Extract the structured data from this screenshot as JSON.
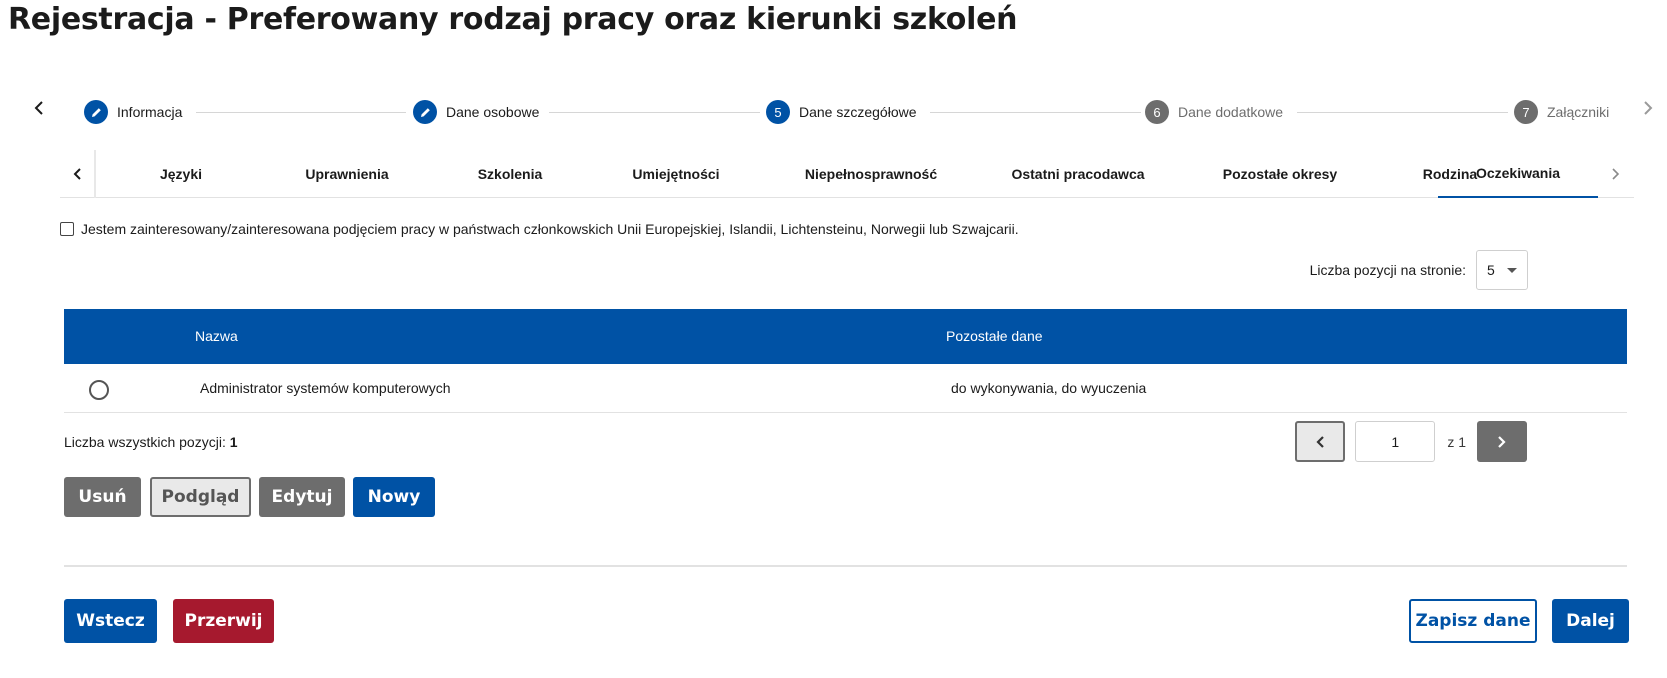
{
  "page": {
    "title": "Rejestracja - Preferowany rodzaj pracy oraz kierunki szkoleń"
  },
  "stepper": {
    "steps": [
      {
        "label": "Informacja",
        "marker": "✎",
        "state": "done"
      },
      {
        "label": "Dane osobowe",
        "marker": "✎",
        "state": "done"
      },
      {
        "label": "Dane szczegółowe",
        "marker": "5",
        "state": "current"
      },
      {
        "label": "Dane dodatkowe",
        "marker": "6",
        "state": "upcoming"
      },
      {
        "label": "Załączniki",
        "marker": "7",
        "state": "upcoming"
      }
    ]
  },
  "tabs": [
    {
      "label": "Języki"
    },
    {
      "label": "Uprawnienia"
    },
    {
      "label": "Szkolenia"
    },
    {
      "label": "Umiejętności"
    },
    {
      "label": "Niepełnosprawność"
    },
    {
      "label": "Ostatni pracodawca"
    },
    {
      "label": "Pozostałe okresy"
    },
    {
      "label": "Rodzina"
    },
    {
      "label": "Oczekiwania",
      "active": true
    }
  ],
  "consent": {
    "label": "Jestem zainteresowany/zainteresowana podjęciem pracy w państwach członkowskich Unii Europejskiej, Islandii, Lichtensteinu, Norwegii lub Szwajcarii.",
    "checked": false
  },
  "page_size": {
    "label": "Liczba pozycji na stronie:",
    "value": "5"
  },
  "table": {
    "columns": [
      "Nazwa",
      "Pozostałe dane"
    ],
    "rows": [
      {
        "name": "Administrator systemów komputerowych",
        "other": "do wykonywania, do wyuczenia",
        "selected": false
      }
    ]
  },
  "total": {
    "label": "Liczba wszystkich pozycji:",
    "value": "1"
  },
  "pagination": {
    "current": "1",
    "of_label": "z 1"
  },
  "actions": {
    "delete": "Usuń",
    "preview": "Podgląd",
    "edit": "Edytuj",
    "new": "Nowy"
  },
  "footer": {
    "back": "Wstecz",
    "abort": "Przerwij",
    "save": "Zapisz dane",
    "next": "Dalej"
  },
  "colors": {
    "primary": "#0052a5",
    "danger": "#a6192e",
    "neutral": "#6d6d6d"
  },
  "icons": {
    "stepper_prev": "chevron-left-icon",
    "stepper_next": "chevron-right-icon",
    "step_done": "pencil-icon",
    "pager_prev": "chevron-left-icon",
    "pager_next": "chevron-right-icon",
    "select": "caret-down-icon"
  }
}
